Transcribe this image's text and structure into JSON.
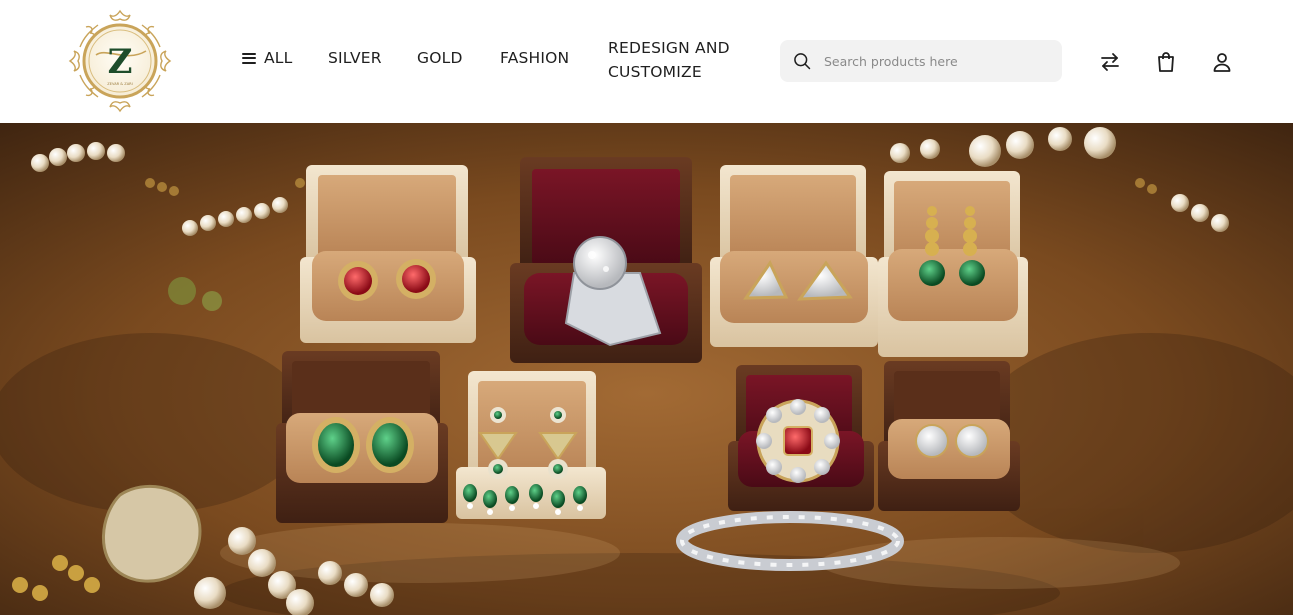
{
  "brand": {
    "logo_letter": "Z",
    "logo_tagline": "ZEVAR & ZARI",
    "logo_icon": "ornate-gold-crest-logo"
  },
  "nav": {
    "all_label": "ALL",
    "silver_label": "SILVER",
    "gold_label": "GOLD",
    "fashion_label": "FASHION",
    "redesign_label": "REDESIGN AND CUSTOMIZE"
  },
  "search": {
    "placeholder": "Search products here",
    "value": ""
  },
  "icons": {
    "compare": "compare-arrows-icon",
    "bag": "shopping-bag-icon",
    "user": "user-account-icon",
    "search": "search-icon",
    "menu": "hamburger-menu-icon"
  },
  "colors": {
    "gold": "#c9a45a",
    "logo_green": "#1e4d2b",
    "search_bg": "#f2f2f2",
    "text": "#1f1f1f"
  },
  "hero": {
    "image": "jewelry-boxes-banner"
  }
}
